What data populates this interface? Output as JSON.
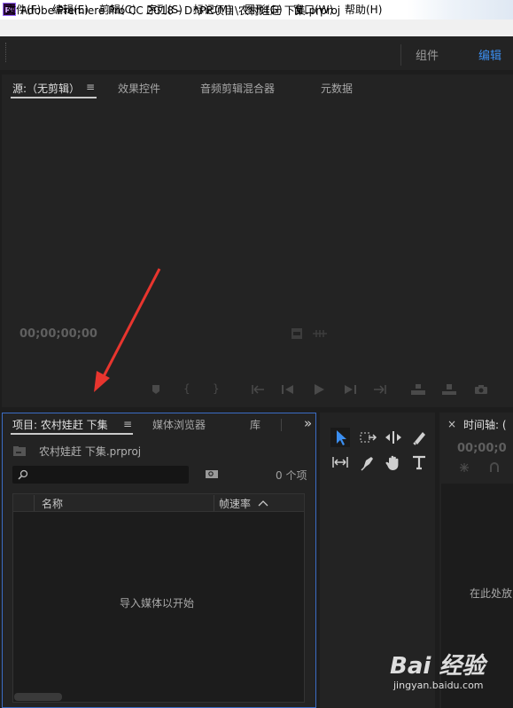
{
  "window": {
    "logo": "Pr",
    "title": "Adobe Premiere Pro CC 2018 - D:\\PR项目\\农村娃赶 下集.prproj"
  },
  "menu": [
    "文件(F)",
    "编辑(E)",
    "剪辑(C)",
    "序列(S)",
    "标记(M)",
    "图形(G)",
    "窗口(W)",
    "帮助(H)"
  ],
  "workspaces": {
    "assembly": "组件",
    "editing": "编辑"
  },
  "source_panel": {
    "tabs": [
      "源:（无剪辑）",
      "效果控件",
      "音频剪辑混合器",
      "元数据"
    ],
    "menu_glyph": "≡",
    "timecode": "00;00;00;00"
  },
  "project_panel": {
    "tabs": [
      "项目: 农村娃赶 下集",
      "媒体浏览器",
      "库"
    ],
    "menu_glyph": "≡",
    "overflow": "»",
    "file_name": "农村娃赶 下集.prproj",
    "item_count": "0 个项",
    "columns": {
      "name": "名称",
      "framerate": "帧速率"
    },
    "empty_hint": "导入媒体以开始"
  },
  "timeline_panel": {
    "close": "×",
    "title": "时间轴: (",
    "timecode": "00;00;0",
    "drop_hint": "在此处放"
  },
  "watermark": {
    "brand": "Bai 经验",
    "url": "jingyan.baidu.com"
  },
  "colors": {
    "accent_blue": "#3b8ef0",
    "panel_focus_border": "#3b6cc4",
    "annotation_red": "#e8352e"
  }
}
